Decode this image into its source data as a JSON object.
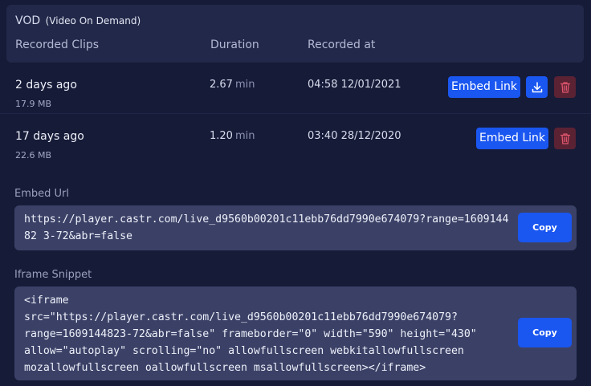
{
  "header": {
    "title": "VOD",
    "title_sub": "(Video On Demand)",
    "columns": [
      "Recorded Clips",
      "Duration",
      "Recorded at"
    ]
  },
  "clips": [
    {
      "age": "2 days ago",
      "size": "17.9 MB",
      "duration": "2.67",
      "duration_unit": "min",
      "recorded_at": "04:58 12/01/2021",
      "embed_label": "Embed Link",
      "has_download": true
    },
    {
      "age": "17 days ago",
      "size": "22.6 MB",
      "duration": "1.20",
      "duration_unit": "min",
      "recorded_at": "03:40 28/12/2020",
      "embed_label": "Embed Link",
      "has_download": false
    }
  ],
  "embed_url": {
    "label": "Embed Url",
    "value": "https://player.castr.com/live_d9560b00201c11ebb76dd7990e674079?range=160914482 3-72&abr=false",
    "copy_label": "Copy"
  },
  "iframe_snippet": {
    "label": "Iframe Snippet",
    "value": "<iframe\nsrc=\"https://player.castr.com/live_d9560b00201c11ebb76dd7990e674079?\nrange=1609144823-72&abr=false\" frameborder=\"0\" width=\"590\" height=\"430\"\nallow=\"autoplay\" scrolling=\"no\" allowfullscreen webkitallowfullscreen\nmozallowfullscreen oallowfullscreen msallowfullscreen></iframe>",
    "copy_label": "Copy"
  },
  "colors": {
    "background": "#161b38",
    "card": "#222849",
    "accent": "#1a56f0",
    "danger": "#5a2233",
    "code_box": "#3b4166"
  },
  "icons": [
    "download-icon",
    "trash-icon"
  ]
}
